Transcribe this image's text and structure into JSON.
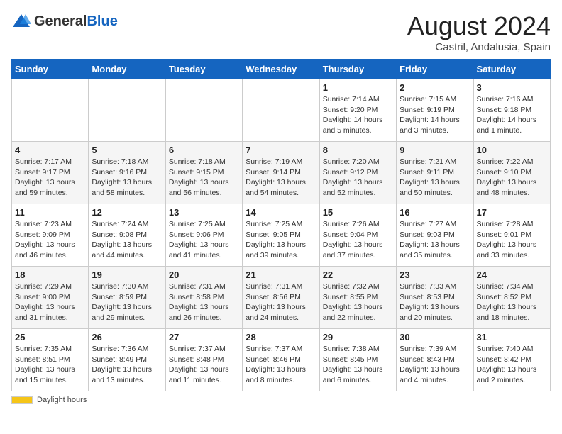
{
  "header": {
    "logo_general": "General",
    "logo_blue": "Blue",
    "month_year": "August 2024",
    "location": "Castril, Andalusia, Spain"
  },
  "weekdays": [
    "Sunday",
    "Monday",
    "Tuesday",
    "Wednesday",
    "Thursday",
    "Friday",
    "Saturday"
  ],
  "weeks": [
    [
      {
        "day": "",
        "info": ""
      },
      {
        "day": "",
        "info": ""
      },
      {
        "day": "",
        "info": ""
      },
      {
        "day": "",
        "info": ""
      },
      {
        "day": "1",
        "info": "Sunrise: 7:14 AM\nSunset: 9:20 PM\nDaylight: 14 hours\nand 5 minutes."
      },
      {
        "day": "2",
        "info": "Sunrise: 7:15 AM\nSunset: 9:19 PM\nDaylight: 14 hours\nand 3 minutes."
      },
      {
        "day": "3",
        "info": "Sunrise: 7:16 AM\nSunset: 9:18 PM\nDaylight: 14 hours\nand 1 minute."
      }
    ],
    [
      {
        "day": "4",
        "info": "Sunrise: 7:17 AM\nSunset: 9:17 PM\nDaylight: 13 hours\nand 59 minutes."
      },
      {
        "day": "5",
        "info": "Sunrise: 7:18 AM\nSunset: 9:16 PM\nDaylight: 13 hours\nand 58 minutes."
      },
      {
        "day": "6",
        "info": "Sunrise: 7:18 AM\nSunset: 9:15 PM\nDaylight: 13 hours\nand 56 minutes."
      },
      {
        "day": "7",
        "info": "Sunrise: 7:19 AM\nSunset: 9:14 PM\nDaylight: 13 hours\nand 54 minutes."
      },
      {
        "day": "8",
        "info": "Sunrise: 7:20 AM\nSunset: 9:12 PM\nDaylight: 13 hours\nand 52 minutes."
      },
      {
        "day": "9",
        "info": "Sunrise: 7:21 AM\nSunset: 9:11 PM\nDaylight: 13 hours\nand 50 minutes."
      },
      {
        "day": "10",
        "info": "Sunrise: 7:22 AM\nSunset: 9:10 PM\nDaylight: 13 hours\nand 48 minutes."
      }
    ],
    [
      {
        "day": "11",
        "info": "Sunrise: 7:23 AM\nSunset: 9:09 PM\nDaylight: 13 hours\nand 46 minutes."
      },
      {
        "day": "12",
        "info": "Sunrise: 7:24 AM\nSunset: 9:08 PM\nDaylight: 13 hours\nand 44 minutes."
      },
      {
        "day": "13",
        "info": "Sunrise: 7:25 AM\nSunset: 9:06 PM\nDaylight: 13 hours\nand 41 minutes."
      },
      {
        "day": "14",
        "info": "Sunrise: 7:25 AM\nSunset: 9:05 PM\nDaylight: 13 hours\nand 39 minutes."
      },
      {
        "day": "15",
        "info": "Sunrise: 7:26 AM\nSunset: 9:04 PM\nDaylight: 13 hours\nand 37 minutes."
      },
      {
        "day": "16",
        "info": "Sunrise: 7:27 AM\nSunset: 9:03 PM\nDaylight: 13 hours\nand 35 minutes."
      },
      {
        "day": "17",
        "info": "Sunrise: 7:28 AM\nSunset: 9:01 PM\nDaylight: 13 hours\nand 33 minutes."
      }
    ],
    [
      {
        "day": "18",
        "info": "Sunrise: 7:29 AM\nSunset: 9:00 PM\nDaylight: 13 hours\nand 31 minutes."
      },
      {
        "day": "19",
        "info": "Sunrise: 7:30 AM\nSunset: 8:59 PM\nDaylight: 13 hours\nand 29 minutes."
      },
      {
        "day": "20",
        "info": "Sunrise: 7:31 AM\nSunset: 8:58 PM\nDaylight: 13 hours\nand 26 minutes."
      },
      {
        "day": "21",
        "info": "Sunrise: 7:31 AM\nSunset: 8:56 PM\nDaylight: 13 hours\nand 24 minutes."
      },
      {
        "day": "22",
        "info": "Sunrise: 7:32 AM\nSunset: 8:55 PM\nDaylight: 13 hours\nand 22 minutes."
      },
      {
        "day": "23",
        "info": "Sunrise: 7:33 AM\nSunset: 8:53 PM\nDaylight: 13 hours\nand 20 minutes."
      },
      {
        "day": "24",
        "info": "Sunrise: 7:34 AM\nSunset: 8:52 PM\nDaylight: 13 hours\nand 18 minutes."
      }
    ],
    [
      {
        "day": "25",
        "info": "Sunrise: 7:35 AM\nSunset: 8:51 PM\nDaylight: 13 hours\nand 15 minutes."
      },
      {
        "day": "26",
        "info": "Sunrise: 7:36 AM\nSunset: 8:49 PM\nDaylight: 13 hours\nand 13 minutes."
      },
      {
        "day": "27",
        "info": "Sunrise: 7:37 AM\nSunset: 8:48 PM\nDaylight: 13 hours\nand 11 minutes."
      },
      {
        "day": "28",
        "info": "Sunrise: 7:37 AM\nSunset: 8:46 PM\nDaylight: 13 hours\nand 8 minutes."
      },
      {
        "day": "29",
        "info": "Sunrise: 7:38 AM\nSunset: 8:45 PM\nDaylight: 13 hours\nand 6 minutes."
      },
      {
        "day": "30",
        "info": "Sunrise: 7:39 AM\nSunset: 8:43 PM\nDaylight: 13 hours\nand 4 minutes."
      },
      {
        "day": "31",
        "info": "Sunrise: 7:40 AM\nSunset: 8:42 PM\nDaylight: 13 hours\nand 2 minutes."
      }
    ]
  ],
  "footer": {
    "daylight_label": "Daylight hours"
  }
}
